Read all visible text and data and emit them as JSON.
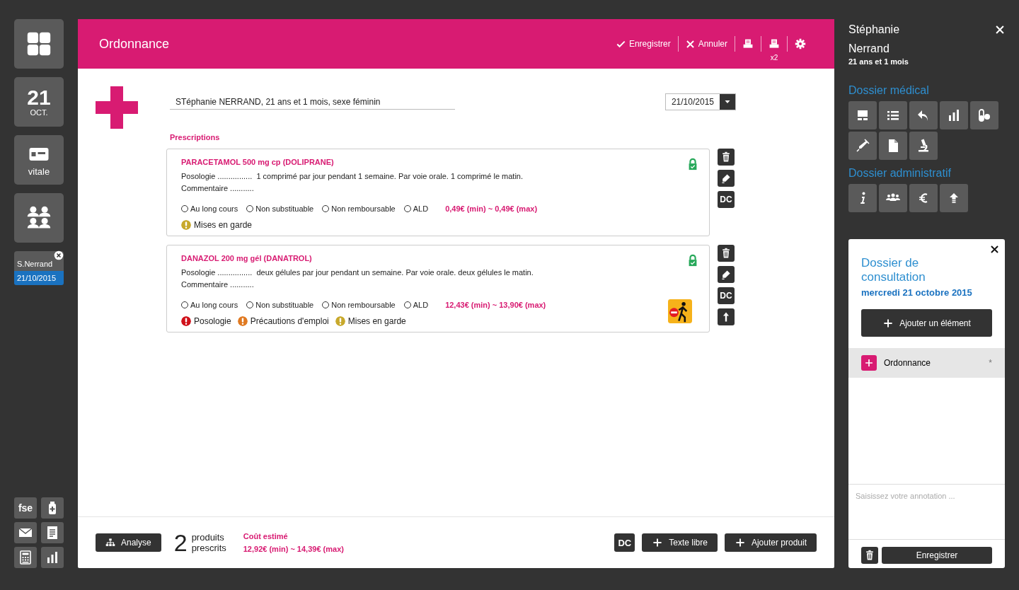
{
  "left_nav": {
    "tiles": [
      {
        "kind": "grid"
      },
      {
        "kind": "date",
        "day": "21",
        "month": "OCT."
      },
      {
        "kind": "card",
        "label": "vitale"
      },
      {
        "kind": "people"
      }
    ],
    "patient_tab": {
      "name": "S.Nerrand",
      "date": "21/10/2015"
    },
    "tools": [
      {
        "kind": "text",
        "label": "fse"
      },
      {
        "kind": "bottle"
      },
      {
        "kind": "mail"
      },
      {
        "kind": "doc"
      },
      {
        "kind": "calc"
      },
      {
        "kind": "bars"
      }
    ]
  },
  "header": {
    "title": "Ordonnance",
    "actions": [
      {
        "kind": "save",
        "label": "Enregistrer"
      },
      {
        "kind": "cancel",
        "label": "Annuler"
      },
      {
        "kind": "print"
      },
      {
        "kind": "print",
        "badge": "x2"
      },
      {
        "kind": "settings"
      }
    ]
  },
  "patient_field": {
    "value": "STéphanie NERRAND, 21 ans et 1 mois, sexe féminin"
  },
  "date_field": {
    "value": "21/10/2015"
  },
  "prescriptions": {
    "title": "Prescriptions",
    "items": [
      {
        "name": "PARACETAMOL 500 mg cp (DOLIPRANE)",
        "posology_label": "Posologie ................",
        "posology": "1 comprimé par jour pendant 1 semaine. Par voie orale. 1 comprimé le matin.",
        "comment_label": "Commentaire ...........",
        "options": [
          {
            "label": "Au long cours",
            "checked": false
          },
          {
            "label": "Non substituable",
            "checked": false
          },
          {
            "label": "Non remboursable",
            "checked": false
          },
          {
            "label": "ALD",
            "checked": false
          }
        ],
        "price": "0,49€ (min) ~ 0,49€ (max)",
        "locked": true,
        "warning_sign": false,
        "warnings": [
          {
            "label": "Mises en garde",
            "color": "#c8a92c"
          }
        ],
        "actions": [
          {
            "kind": "trash"
          },
          {
            "kind": "edit"
          },
          {
            "kind": "text",
            "label": "DC"
          }
        ]
      },
      {
        "name": "DANAZOL 200 mg gél (DANATROL)",
        "posology_label": "Posologie ................",
        "posology": "deux gélules par jour pendant un semaine. Par voie orale. deux gélules le matin.",
        "comment_label": "Commentaire ...........",
        "options": [
          {
            "label": "Au long cours",
            "checked": false
          },
          {
            "label": "Non substituable",
            "checked": false
          },
          {
            "label": "Non remboursable",
            "checked": false
          },
          {
            "label": "ALD",
            "checked": false
          }
        ],
        "price": "12,43€ (min) ~ 13,90€ (max)",
        "locked": true,
        "warning_sign": true,
        "warnings": [
          {
            "label": "Posologie",
            "color": "#d0121b"
          },
          {
            "label": "Précautions d'emploi",
            "color": "#e07a22"
          },
          {
            "label": "Mises en garde",
            "color": "#c8a92c"
          }
        ],
        "actions": [
          {
            "kind": "trash"
          },
          {
            "kind": "edit"
          },
          {
            "kind": "text",
            "label": "DC"
          },
          {
            "kind": "up"
          }
        ]
      }
    ]
  },
  "footer": {
    "analyse": "Analyse",
    "count": "2",
    "count_lines": [
      "produits",
      "prescrits"
    ],
    "cost_label": "Coût estimé",
    "cost": "12,92€ (min) ~ 14,39€ (max)",
    "buttons": [
      {
        "kind": "text",
        "label": "DC"
      },
      {
        "kind": "add",
        "label": "Texte libre"
      },
      {
        "kind": "add",
        "label": "Ajouter produit"
      }
    ]
  },
  "patient": {
    "first_name": "Stéphanie",
    "last_name": "Nerrand",
    "age": "21 ans et 1 mois"
  },
  "medical": {
    "title": "Dossier médical",
    "icons": [
      {
        "kind": "screen"
      },
      {
        "kind": "list"
      },
      {
        "kind": "reply"
      },
      {
        "kind": "bars"
      },
      {
        "kind": "pills"
      },
      {
        "kind": "syringe"
      },
      {
        "kind": "file"
      },
      {
        "kind": "microscope"
      }
    ]
  },
  "administrative": {
    "title": "Dossier administratif",
    "icons": [
      {
        "kind": "info"
      },
      {
        "kind": "group"
      },
      {
        "kind": "euro"
      },
      {
        "kind": "upload"
      }
    ]
  },
  "consultation": {
    "title": "Dossier de consultation",
    "date": "mercredi 21 octobre 2015",
    "add_button": "Ajouter un élément",
    "items": [
      {
        "label": "Ordonnance",
        "mark": "*",
        "selected": true
      }
    ],
    "annotation_placeholder": "Saisissez votre annotation ...",
    "save": "Enregistrer"
  }
}
